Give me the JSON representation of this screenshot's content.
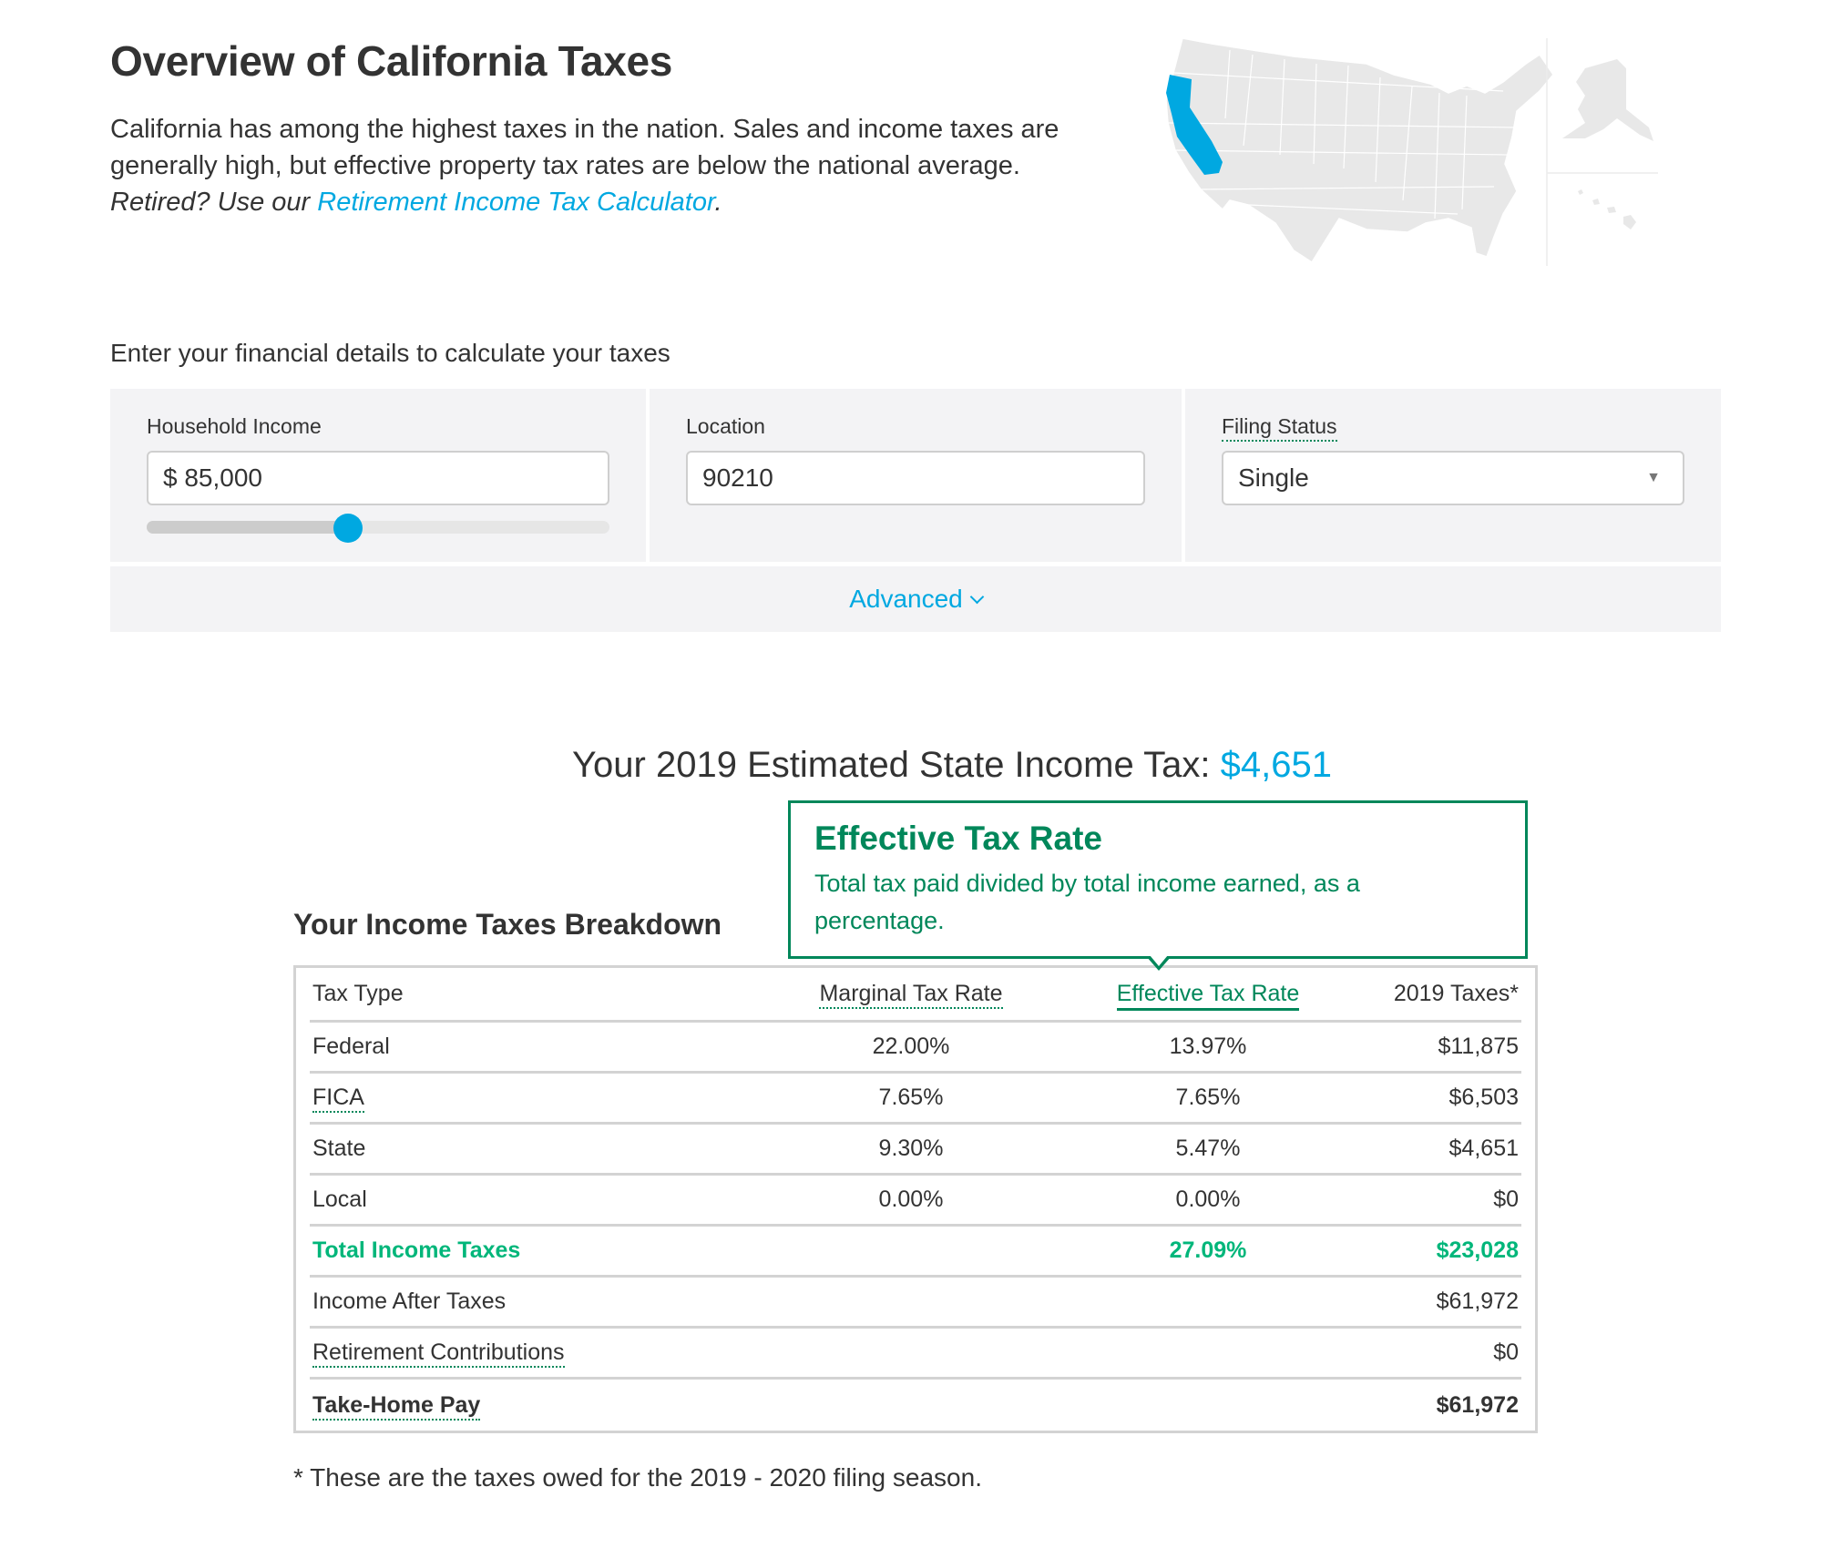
{
  "header": {
    "title": "Overview of California Taxes",
    "intro": "California has among the highest taxes in the nation. Sales and income taxes are generally high, but effective property tax rates are below the national average.",
    "retired_prompt": "Retired? Use our ",
    "retirement_link": "Retirement Income Tax Calculator",
    "retirement_link_suffix": "."
  },
  "map": {
    "highlighted_state": "California",
    "highlight_color": "#00a8e1",
    "base_color": "#e8e8e8"
  },
  "calculator": {
    "prompt": "Enter your financial details to calculate your taxes",
    "income": {
      "label": "Household Income",
      "value": "$ 85,000",
      "slider_fraction": 0.435
    },
    "location": {
      "label": "Location",
      "value": "90210"
    },
    "filing_status": {
      "label": "Filing Status",
      "selected": "Single"
    },
    "advanced_label": "Advanced"
  },
  "estimate": {
    "label": "Your 2019 Estimated State Income Tax: ",
    "amount": "$4,651"
  },
  "tooltip": {
    "title": "Effective Tax Rate",
    "body": "Total tax paid divided by total income earned, as a percentage."
  },
  "breakdown": {
    "title": "Your Income Taxes Breakdown",
    "columns": [
      "Tax Type",
      "Marginal Tax Rate",
      "Effective Tax Rate",
      "2019 Taxes*"
    ],
    "rows": [
      {
        "type": "Federal",
        "marginal": "22.00%",
        "effective": "13.97%",
        "taxes": "$11,875"
      },
      {
        "type": "FICA",
        "marginal": "7.65%",
        "effective": "7.65%",
        "taxes": "$6,503"
      },
      {
        "type": "State",
        "marginal": "9.30%",
        "effective": "5.47%",
        "taxes": "$4,651"
      },
      {
        "type": "Local",
        "marginal": "0.00%",
        "effective": "0.00%",
        "taxes": "$0"
      }
    ],
    "total": {
      "label": "Total Income Taxes",
      "effective": "27.09%",
      "taxes": "$23,028"
    },
    "income_after_taxes": {
      "label": "Income After Taxes",
      "value": "$61,972"
    },
    "retirement_contributions": {
      "label": "Retirement Contributions",
      "value": "$0"
    },
    "take_home_pay": {
      "label": "Take-Home Pay",
      "value": "$61,972"
    },
    "accent_color": "#00875a",
    "total_color": "#00b67a"
  },
  "footnote": "* These are the taxes owed for the 2019 - 2020 filing season."
}
